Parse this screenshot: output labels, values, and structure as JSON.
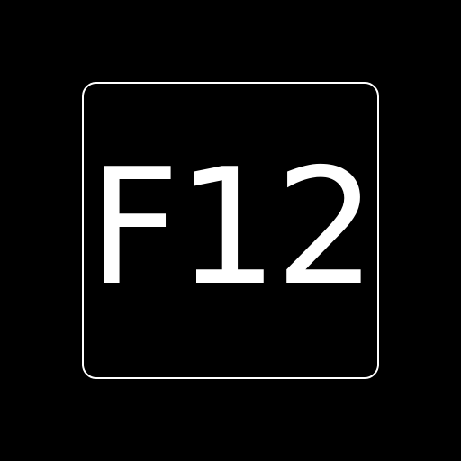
{
  "key": {
    "label": "F12"
  },
  "colors": {
    "background": "#000000",
    "foreground": "#ffffff"
  }
}
